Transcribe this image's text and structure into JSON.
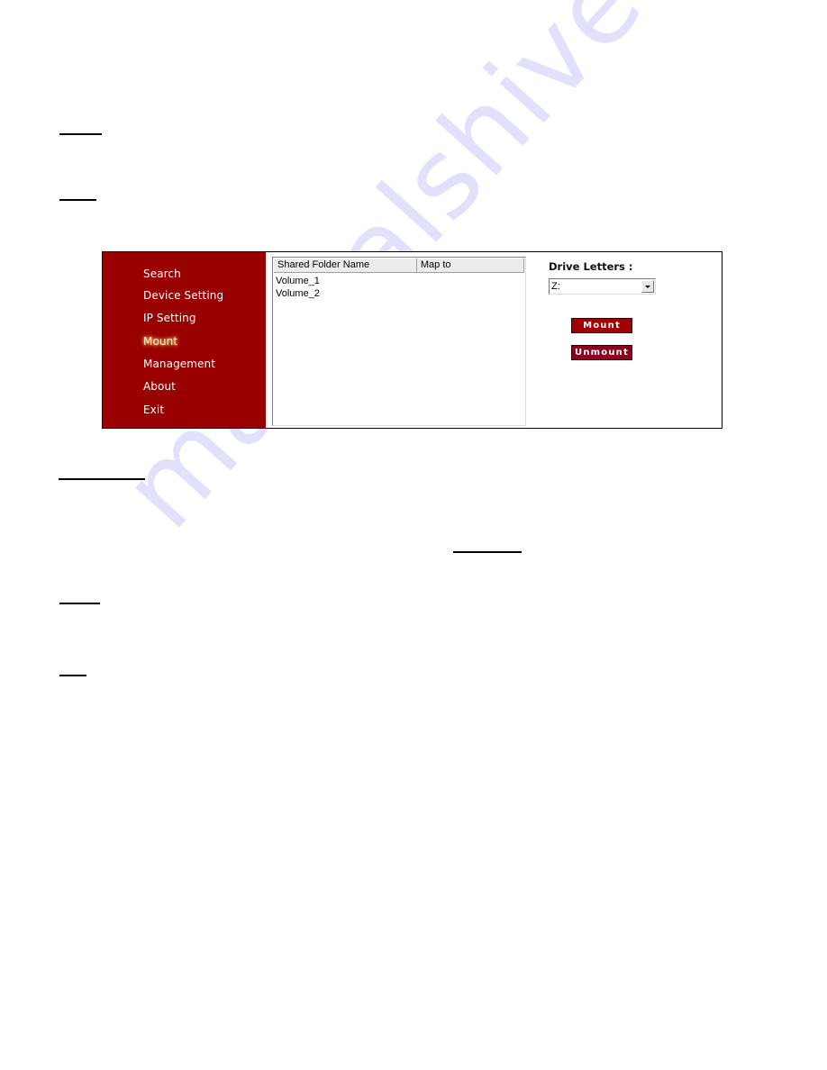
{
  "document": {
    "watermark_text": "manualshive.com"
  },
  "app": {
    "sidebar": {
      "items": [
        {
          "label": "Search",
          "active": false
        },
        {
          "label": "Device Setting",
          "active": false
        },
        {
          "label": "IP Setting",
          "active": false
        },
        {
          "label": "Mount",
          "active": true
        },
        {
          "label": "Management",
          "active": false
        },
        {
          "label": "About",
          "active": false
        },
        {
          "label": "Exit",
          "active": false
        }
      ]
    },
    "shared_folders": {
      "columns": [
        "Shared Folder Name",
        "Map to"
      ],
      "rows": [
        {
          "name": "Volume_1",
          "map_to": ""
        },
        {
          "name": "Volume_2",
          "map_to": ""
        }
      ]
    },
    "drive_letters": {
      "label": "Drive Letters :",
      "selected": "Z:"
    },
    "buttons": {
      "mount": "Mount",
      "unmount": "Unmount"
    },
    "colors": {
      "sidebar_bg": "#990000",
      "button_bg": "#a00000",
      "active_item_glow": "#ffd27a"
    }
  }
}
